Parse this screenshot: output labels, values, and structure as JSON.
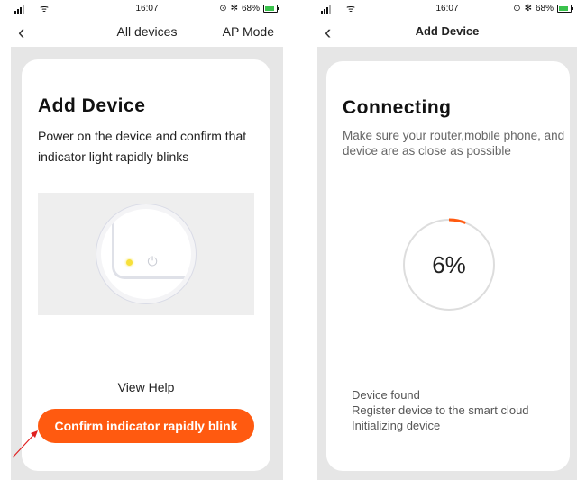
{
  "status_bar": {
    "time": "16:07",
    "battery_text": "68%",
    "bluetooth_glyph": "✻",
    "alarm_glyph": "⊙",
    "wifi_glyph": "ᯤ"
  },
  "left_screen": {
    "nav": {
      "back_glyph": "‹",
      "title": "All devices",
      "action": "AP Mode"
    },
    "heading": "Add Device",
    "description": "Power on the device and confirm that indicator light rapidly blinks",
    "view_help": "View Help",
    "confirm_button": "Confirm indicator rapidly blink",
    "icons": {
      "power": "power-icon",
      "indicator_light": "indicator-light-icon"
    }
  },
  "right_screen": {
    "nav": {
      "back_glyph": "‹",
      "title": "Add Device"
    },
    "heading": "Connecting",
    "description": "Make sure your router,mobile phone, and device are as close as possible",
    "progress": {
      "value": 6,
      "label": "6%"
    },
    "status_steps": [
      "Device found",
      "Register device to the smart cloud",
      "Initializing device"
    ]
  },
  "colors": {
    "accent": "#ff5a10",
    "progress_track": "#dddddd",
    "background": "#e6e6e6",
    "card": "#ffffff",
    "indicator_led": "#f7e03a"
  }
}
